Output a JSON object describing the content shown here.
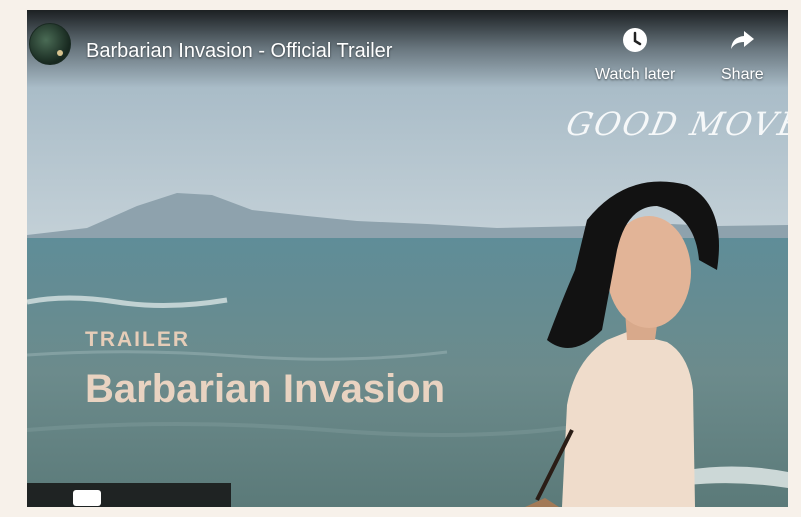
{
  "video": {
    "title": "Barbarian Invasion - Official Trailer",
    "watch_later_label": "Watch later",
    "share_label": "Share"
  },
  "overlay": {
    "watermark": "GOOD MOVE",
    "kicker": "TRAILER",
    "title": "Barbarian Invasion"
  },
  "icons": {
    "channel": "channel-avatar",
    "watch_later": "clock-icon",
    "share": "share-arrow-icon",
    "youtube": "youtube-logo-icon"
  },
  "colors": {
    "overlay_text": "#e9d3c1",
    "page_background": "#f7f1ea"
  }
}
